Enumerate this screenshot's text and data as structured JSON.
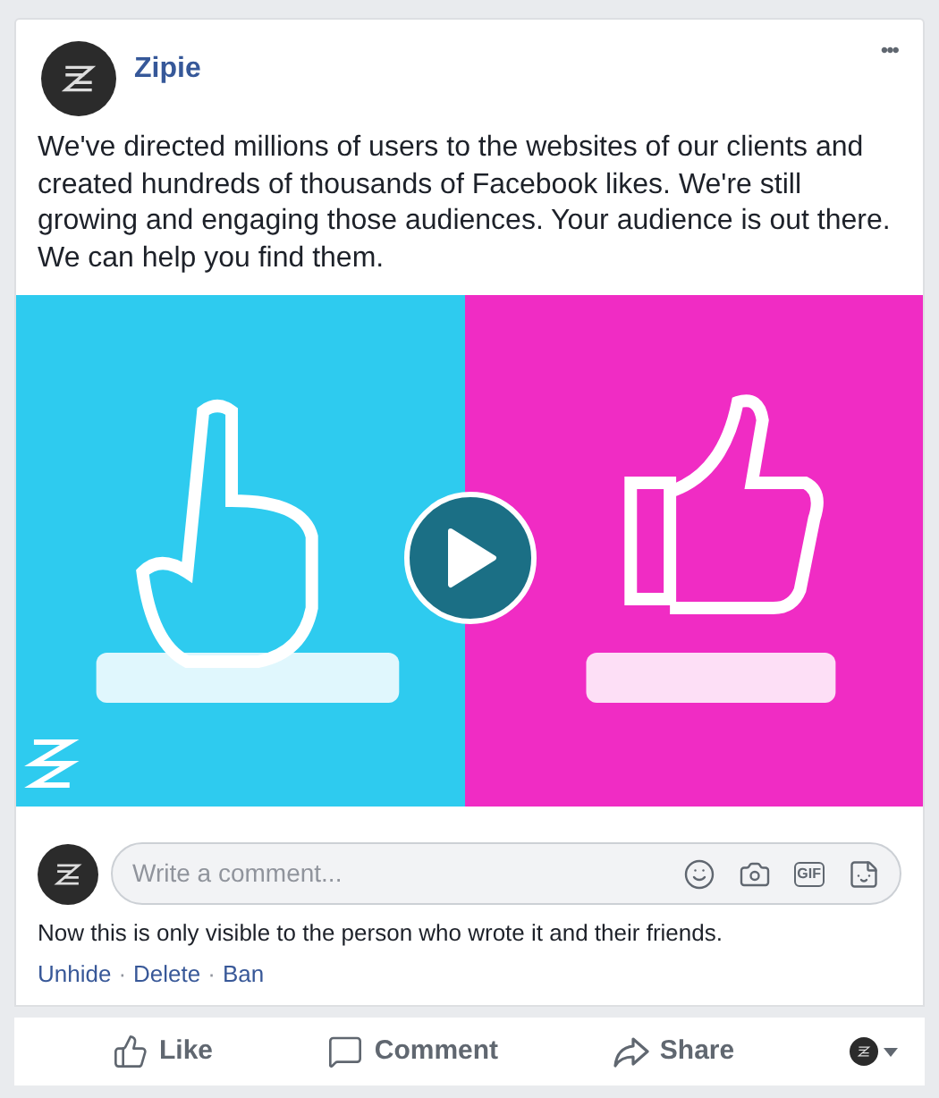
{
  "post": {
    "author": "Zipie",
    "more": "•••",
    "text": "We've directed millions of users to the websites of our clients and created hundreds of thousands of Facebook likes. We're still growing and engaging those audiences. Your audience is out there. We can help you find them."
  },
  "comment_box": {
    "placeholder": "Write a comment...",
    "gif_label": "GIF"
  },
  "notice": "Now this is only visible to the person who wrote it and their friends.",
  "moderation_links": [
    "Unhide",
    "·",
    "Delete",
    "·",
    "Ban"
  ],
  "actions": [
    {
      "kind": "like",
      "label": "Like"
    },
    {
      "kind": "comment",
      "label": "Comment"
    },
    {
      "kind": "share",
      "label": "Share"
    }
  ]
}
